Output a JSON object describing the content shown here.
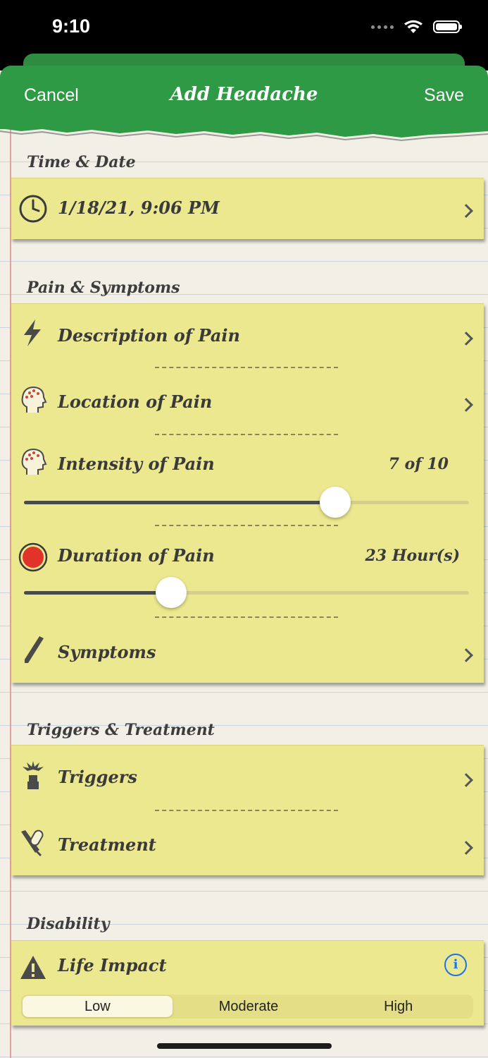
{
  "status_bar": {
    "time": "9:10"
  },
  "nav": {
    "cancel": "Cancel",
    "title": "Add Headache",
    "save": "Save"
  },
  "sections": {
    "time_date": {
      "title": "Time & Date",
      "value": "1/18/21, 9:06 PM",
      "icon": "clock-icon"
    },
    "pain": {
      "title": "Pain & Symptoms",
      "description": {
        "label": "Description of Pain",
        "icon": "lightning-icon"
      },
      "location": {
        "label": "Location of Pain",
        "icon": "head-icon"
      },
      "intensity": {
        "label": "Intensity of Pain",
        "value": "7 of 10",
        "level": 7,
        "max": 10,
        "icon": "head-icon"
      },
      "duration": {
        "label": "Duration of Pain",
        "value": "23 Hour(s)",
        "level_fraction": 0.33,
        "icon": "red-circle-icon"
      },
      "symptoms": {
        "label": "Symptoms",
        "icon": "pen-icon"
      }
    },
    "triggers_treatment": {
      "title": "Triggers & Treatment",
      "triggers": {
        "label": "Triggers",
        "icon": "burst-person-icon"
      },
      "treatment": {
        "label": "Treatment",
        "icon": "pill-syringe-icon"
      }
    },
    "disability": {
      "title": "Disability",
      "life_impact": {
        "label": "Life Impact",
        "icon": "warning-icon"
      },
      "options": [
        "Low",
        "Moderate",
        "High"
      ],
      "selected": "Low"
    }
  },
  "colors": {
    "nav_green": "#2f9a45",
    "card_yellow": "#ece88f",
    "info_blue": "#1a73e8"
  }
}
